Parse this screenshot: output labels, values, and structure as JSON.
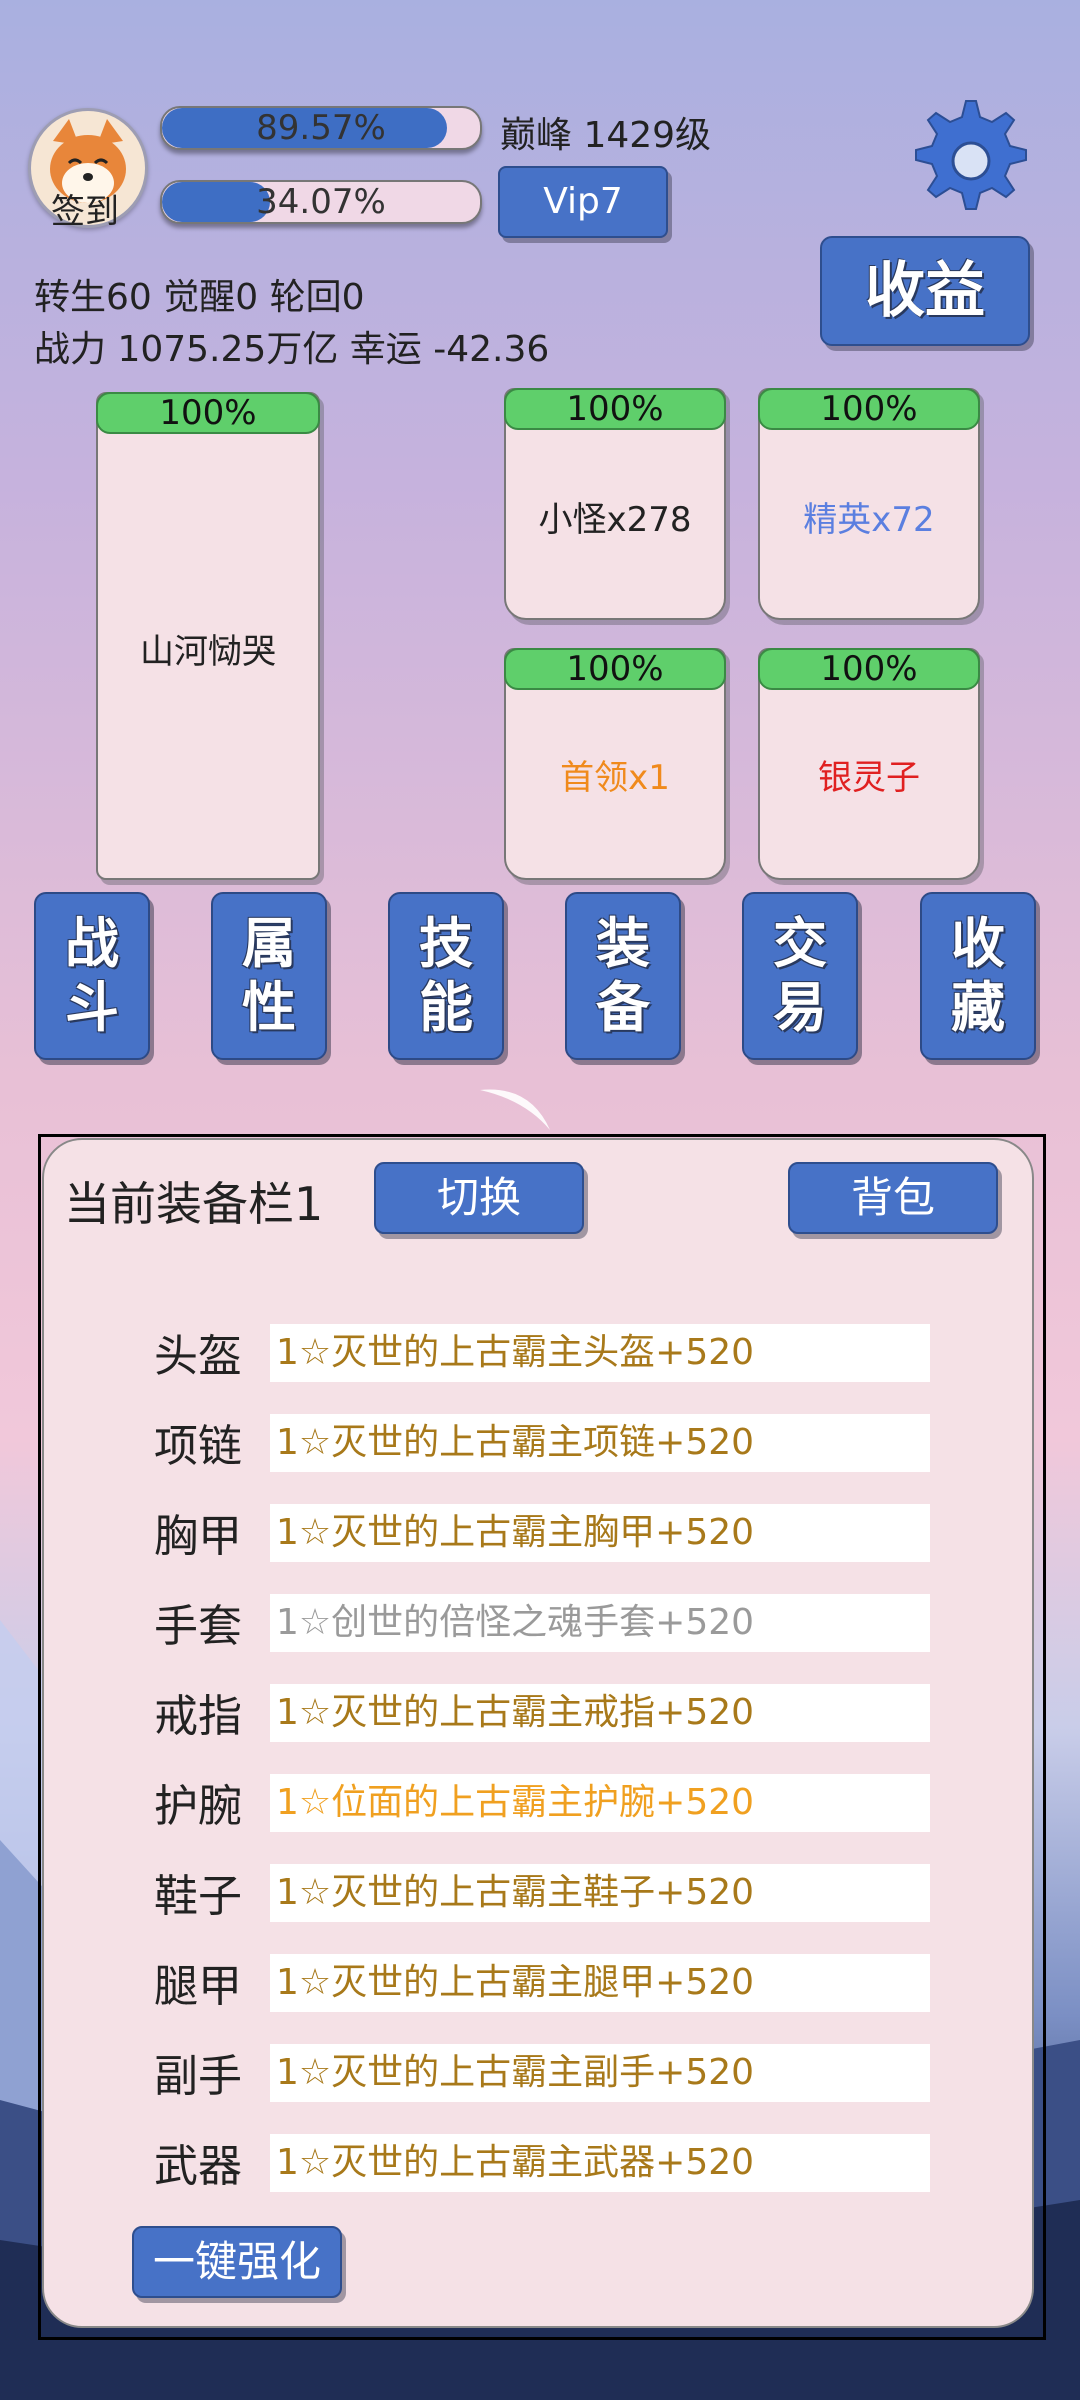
{
  "header": {
    "signin_label": "签到",
    "exp_bar": {
      "percent_text": "89.57%",
      "fill_fraction": 0.8957
    },
    "level_text": "巅峰 1429级",
    "second_bar": {
      "percent_text": "34.07%",
      "fill_fraction": 0.3407
    },
    "vip_label": "Vip7",
    "income_label": "收益"
  },
  "stats": {
    "line1": "转生60 觉醒0 轮回0",
    "line2": "战力 1075.25万亿  幸运 -42.36"
  },
  "cards": {
    "main": {
      "percent": "100%",
      "name": "山河恸哭",
      "color": "#222222"
    },
    "minion": {
      "percent": "100%",
      "name": "小怪x278",
      "color": "#222222"
    },
    "elite": {
      "percent": "100%",
      "name": "精英x72",
      "color": "#5b7fe0"
    },
    "boss": {
      "percent": "100%",
      "name": "首领x1",
      "color": "#f08a1c"
    },
    "silver": {
      "percent": "100%",
      "name": "银灵子",
      "color": "#e02020"
    }
  },
  "nav": [
    {
      "line1": "战",
      "line2": "斗"
    },
    {
      "line1": "属",
      "line2": "性"
    },
    {
      "line1": "技",
      "line2": "能"
    },
    {
      "line1": "装",
      "line2": "备"
    },
    {
      "line1": "交",
      "line2": "易"
    },
    {
      "line1": "收",
      "line2": "藏"
    }
  ],
  "equipment": {
    "title": "当前装备栏1",
    "switch_label": "切换",
    "bag_label": "背包",
    "slots": [
      {
        "label": "头盔",
        "item": "1☆灭世的上古霸主头盔+520",
        "color": "#a8791a"
      },
      {
        "label": "项链",
        "item": "1☆灭世的上古霸主项链+520",
        "color": "#a8791a"
      },
      {
        "label": "胸甲",
        "item": "1☆灭世的上古霸主胸甲+520",
        "color": "#a8791a"
      },
      {
        "label": "手套",
        "item": "1☆创世的倍怪之魂手套+520",
        "color": "#9a9a9a"
      },
      {
        "label": "戒指",
        "item": "1☆灭世的上古霸主戒指+520",
        "color": "#a8791a"
      },
      {
        "label": "护腕",
        "item": "1☆位面的上古霸主护腕+520",
        "color": "#f0a020"
      },
      {
        "label": "鞋子",
        "item": "1☆灭世的上古霸主鞋子+520",
        "color": "#a8791a"
      },
      {
        "label": "腿甲",
        "item": "1☆灭世的上古霸主腿甲+520",
        "color": "#a8791a"
      },
      {
        "label": "副手",
        "item": "1☆灭世的上古霸主副手+520",
        "color": "#a8791a"
      },
      {
        "label": "武器",
        "item": "1☆灭世的上古霸主武器+520",
        "color": "#a8791a"
      }
    ],
    "enhance_label": "一键强化"
  }
}
